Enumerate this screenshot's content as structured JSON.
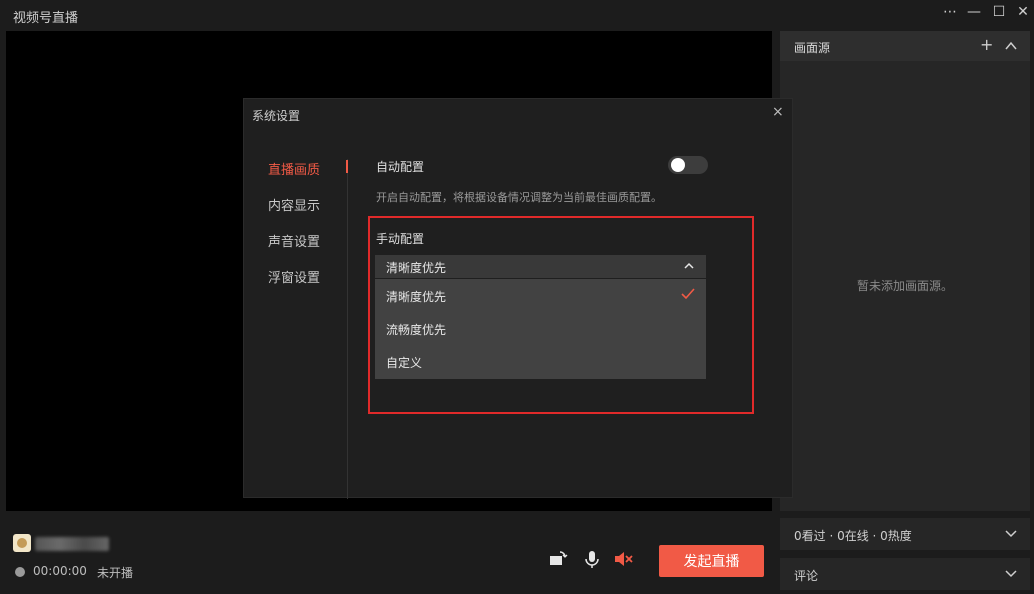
{
  "app": {
    "title": "视频号直播"
  },
  "window": {
    "more_icon": "ellipsis-icon",
    "minimize_icon": "minimize-icon",
    "maximize_icon": "maximize-icon",
    "close_icon": "close-icon"
  },
  "right_panel": {
    "sources_title": "画面源",
    "empty_text": "暂未添加画面源。",
    "stats": "0看过 · 0在线 · 0热度",
    "comments": "评论"
  },
  "bottom": {
    "time": "00:00:00",
    "status": "未开播",
    "start_button": "发起直播"
  },
  "dialog": {
    "title": "系统设置",
    "nav": [
      {
        "label": "直播画质",
        "active": true
      },
      {
        "label": "内容显示",
        "active": false
      },
      {
        "label": "声音设置",
        "active": false
      },
      {
        "label": "浮窗设置",
        "active": false
      }
    ],
    "auto_config": {
      "label": "自动配置",
      "enabled": false,
      "description": "开启自动配置，将根据设备情况调整为当前最佳画质配置。"
    },
    "manual_config": {
      "label": "手动配置",
      "selected": "清晰度优先",
      "options": [
        {
          "label": "清晰度优先",
          "checked": true
        },
        {
          "label": "流畅度优先",
          "checked": false
        },
        {
          "label": "自定义",
          "checked": false
        }
      ]
    }
  },
  "colors": {
    "accent": "#f15a46",
    "highlight": "#e02a2a"
  }
}
